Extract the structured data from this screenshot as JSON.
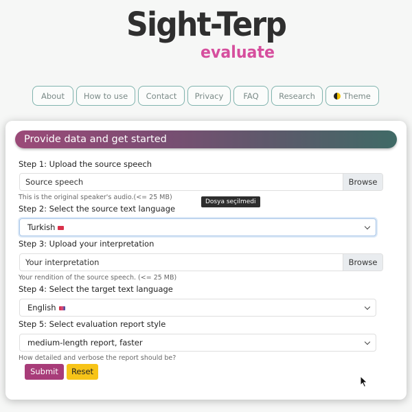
{
  "logo": {
    "main": "Sight-Terp",
    "sub": "evaluate"
  },
  "nav": [
    {
      "label": "About"
    },
    {
      "label": "How to use"
    },
    {
      "label": "Contact"
    },
    {
      "label": "Privacy"
    },
    {
      "label": "FAQ"
    },
    {
      "label": "Research"
    },
    {
      "label": "Theme",
      "icon": "theme-toggle-icon"
    }
  ],
  "card": {
    "title": "Provide data and get started",
    "step1": {
      "label": "Step 1: Upload the source speech",
      "placeholder": "Source speech",
      "button": "Browse",
      "help": "This is the original speaker's audio.(<= 25 MB)"
    },
    "tooltip": "Dosya seçilmedi",
    "step2": {
      "label": "Step 2: Select the source text language",
      "value": "Turkish",
      "flag_icon": "turkey-flag-icon"
    },
    "step3": {
      "label": "Step 3: Upload your interpretation",
      "placeholder": "Your interpretation",
      "button": "Browse",
      "help": "Your rendition of the source speech. (<= 25 MB)"
    },
    "step4": {
      "label": "Step 4: Select the target text language",
      "value": "English",
      "flag_icon": "uk-flag-icon"
    },
    "step5": {
      "label": "Step 5: Select evaluation report style",
      "value": "medium-length report, faster",
      "help": "How detailed and verbose the report should be?"
    },
    "submit": "Submit",
    "reset": "Reset"
  },
  "colors": {
    "accent": "#a83c79",
    "reset": "#f7c418",
    "nav_border": "#7fb3ad",
    "logo_sub": "#d64f9e"
  }
}
